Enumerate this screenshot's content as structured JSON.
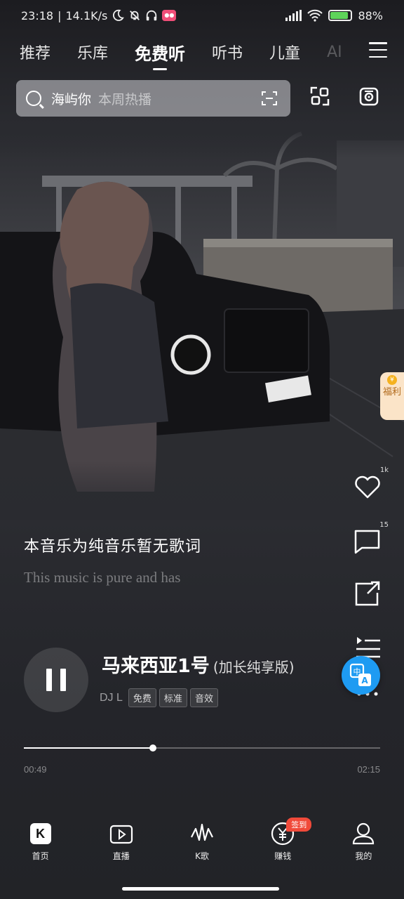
{
  "status_bar": {
    "time": "23:18",
    "net_speed": "14.1K/s",
    "battery": "88%",
    "battery_level": 0.88
  },
  "tabs": [
    {
      "label": "推荐",
      "active": false
    },
    {
      "label": "乐库",
      "active": false
    },
    {
      "label": "免费听",
      "active": true
    },
    {
      "label": "听书",
      "active": false
    },
    {
      "label": "儿童",
      "active": false
    },
    {
      "label": "AI",
      "active": false
    }
  ],
  "search": {
    "query": "海屿你",
    "hint": "本周热播"
  },
  "welfare": {
    "label": "福利",
    "coin": "¥"
  },
  "lyrics": {
    "line1": "本音乐为纯音乐暂无歌词",
    "line2": "This music is pure and has"
  },
  "actions": {
    "like_count": "1k",
    "comment_count": "15"
  },
  "song": {
    "title": "马来西亚1号",
    "version": "(加长纯享版)",
    "artist": "DJ L",
    "tags": [
      "免费",
      "标准",
      "音效"
    ]
  },
  "playback": {
    "elapsed": "00:49",
    "total": "02:15",
    "progress": 0.363
  },
  "nav": [
    {
      "label": "首页",
      "icon": "k-logo-icon"
    },
    {
      "label": "直播",
      "icon": "live-icon"
    },
    {
      "label": "K歌",
      "icon": "sing-icon"
    },
    {
      "label": "赚钱",
      "icon": "coin-icon",
      "badge": "签到"
    },
    {
      "label": "我的",
      "icon": "profile-icon"
    }
  ],
  "colors": {
    "accent_blue": "#1e9bf2",
    "badge_red": "#f04a3a",
    "welfare_bg": "#fbe4c8"
  }
}
